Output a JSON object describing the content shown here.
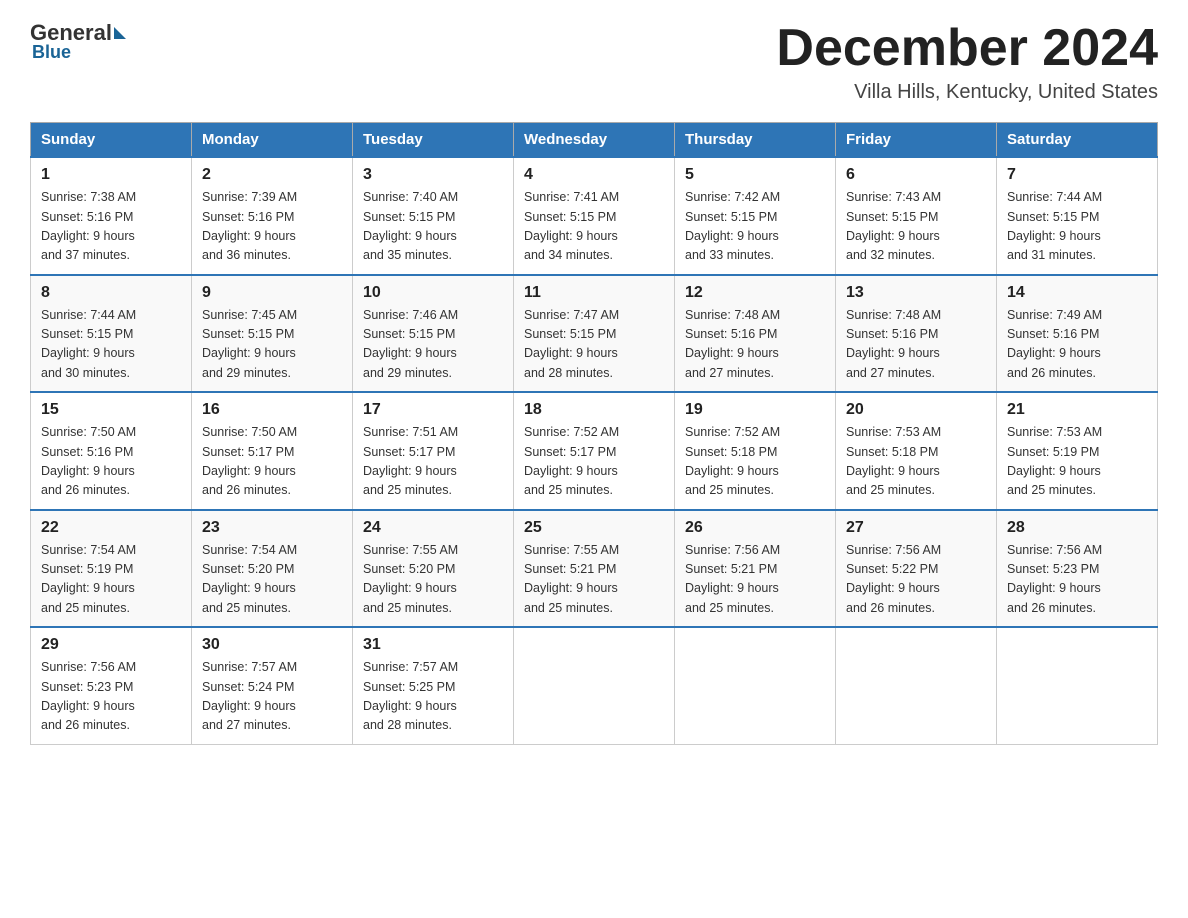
{
  "header": {
    "logo_general": "General",
    "logo_blue": "Blue",
    "month_title": "December 2024",
    "location": "Villa Hills, Kentucky, United States"
  },
  "days_of_week": [
    "Sunday",
    "Monday",
    "Tuesday",
    "Wednesday",
    "Thursday",
    "Friday",
    "Saturday"
  ],
  "weeks": [
    [
      {
        "day": "1",
        "sunrise": "7:38 AM",
        "sunset": "5:16 PM",
        "daylight": "9 hours and 37 minutes."
      },
      {
        "day": "2",
        "sunrise": "7:39 AM",
        "sunset": "5:16 PM",
        "daylight": "9 hours and 36 minutes."
      },
      {
        "day": "3",
        "sunrise": "7:40 AM",
        "sunset": "5:15 PM",
        "daylight": "9 hours and 35 minutes."
      },
      {
        "day": "4",
        "sunrise": "7:41 AM",
        "sunset": "5:15 PM",
        "daylight": "9 hours and 34 minutes."
      },
      {
        "day": "5",
        "sunrise": "7:42 AM",
        "sunset": "5:15 PM",
        "daylight": "9 hours and 33 minutes."
      },
      {
        "day": "6",
        "sunrise": "7:43 AM",
        "sunset": "5:15 PM",
        "daylight": "9 hours and 32 minutes."
      },
      {
        "day": "7",
        "sunrise": "7:44 AM",
        "sunset": "5:15 PM",
        "daylight": "9 hours and 31 minutes."
      }
    ],
    [
      {
        "day": "8",
        "sunrise": "7:44 AM",
        "sunset": "5:15 PM",
        "daylight": "9 hours and 30 minutes."
      },
      {
        "day": "9",
        "sunrise": "7:45 AM",
        "sunset": "5:15 PM",
        "daylight": "9 hours and 29 minutes."
      },
      {
        "day": "10",
        "sunrise": "7:46 AM",
        "sunset": "5:15 PM",
        "daylight": "9 hours and 29 minutes."
      },
      {
        "day": "11",
        "sunrise": "7:47 AM",
        "sunset": "5:15 PM",
        "daylight": "9 hours and 28 minutes."
      },
      {
        "day": "12",
        "sunrise": "7:48 AM",
        "sunset": "5:16 PM",
        "daylight": "9 hours and 27 minutes."
      },
      {
        "day": "13",
        "sunrise": "7:48 AM",
        "sunset": "5:16 PM",
        "daylight": "9 hours and 27 minutes."
      },
      {
        "day": "14",
        "sunrise": "7:49 AM",
        "sunset": "5:16 PM",
        "daylight": "9 hours and 26 minutes."
      }
    ],
    [
      {
        "day": "15",
        "sunrise": "7:50 AM",
        "sunset": "5:16 PM",
        "daylight": "9 hours and 26 minutes."
      },
      {
        "day": "16",
        "sunrise": "7:50 AM",
        "sunset": "5:17 PM",
        "daylight": "9 hours and 26 minutes."
      },
      {
        "day": "17",
        "sunrise": "7:51 AM",
        "sunset": "5:17 PM",
        "daylight": "9 hours and 25 minutes."
      },
      {
        "day": "18",
        "sunrise": "7:52 AM",
        "sunset": "5:17 PM",
        "daylight": "9 hours and 25 minutes."
      },
      {
        "day": "19",
        "sunrise": "7:52 AM",
        "sunset": "5:18 PM",
        "daylight": "9 hours and 25 minutes."
      },
      {
        "day": "20",
        "sunrise": "7:53 AM",
        "sunset": "5:18 PM",
        "daylight": "9 hours and 25 minutes."
      },
      {
        "day": "21",
        "sunrise": "7:53 AM",
        "sunset": "5:19 PM",
        "daylight": "9 hours and 25 minutes."
      }
    ],
    [
      {
        "day": "22",
        "sunrise": "7:54 AM",
        "sunset": "5:19 PM",
        "daylight": "9 hours and 25 minutes."
      },
      {
        "day": "23",
        "sunrise": "7:54 AM",
        "sunset": "5:20 PM",
        "daylight": "9 hours and 25 minutes."
      },
      {
        "day": "24",
        "sunrise": "7:55 AM",
        "sunset": "5:20 PM",
        "daylight": "9 hours and 25 minutes."
      },
      {
        "day": "25",
        "sunrise": "7:55 AM",
        "sunset": "5:21 PM",
        "daylight": "9 hours and 25 minutes."
      },
      {
        "day": "26",
        "sunrise": "7:56 AM",
        "sunset": "5:21 PM",
        "daylight": "9 hours and 25 minutes."
      },
      {
        "day": "27",
        "sunrise": "7:56 AM",
        "sunset": "5:22 PM",
        "daylight": "9 hours and 26 minutes."
      },
      {
        "day": "28",
        "sunrise": "7:56 AM",
        "sunset": "5:23 PM",
        "daylight": "9 hours and 26 minutes."
      }
    ],
    [
      {
        "day": "29",
        "sunrise": "7:56 AM",
        "sunset": "5:23 PM",
        "daylight": "9 hours and 26 minutes."
      },
      {
        "day": "30",
        "sunrise": "7:57 AM",
        "sunset": "5:24 PM",
        "daylight": "9 hours and 27 minutes."
      },
      {
        "day": "31",
        "sunrise": "7:57 AM",
        "sunset": "5:25 PM",
        "daylight": "9 hours and 28 minutes."
      },
      null,
      null,
      null,
      null
    ]
  ],
  "labels": {
    "sunrise": "Sunrise:",
    "sunset": "Sunset:",
    "daylight": "Daylight:"
  }
}
